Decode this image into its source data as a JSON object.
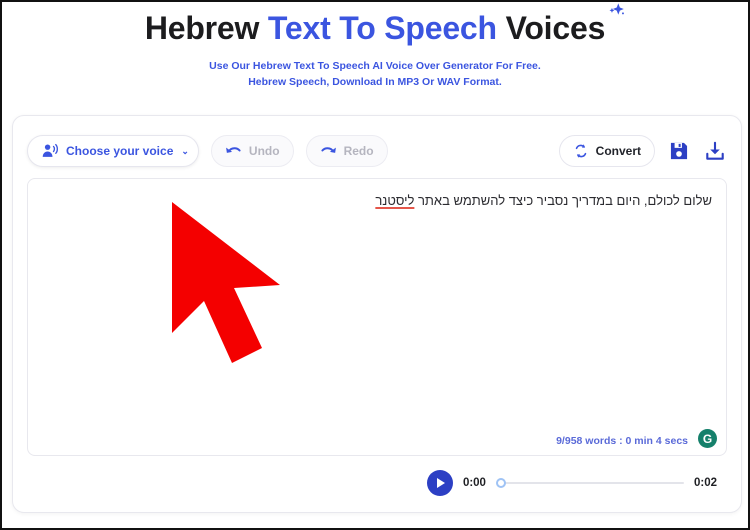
{
  "header": {
    "title_part1": "Hebrew ",
    "title_accent": "Text To Speech",
    "title_part2": " Voices",
    "sparkle_icon": "sparkle-icon",
    "subtitle_line1": "Use Our Hebrew Text To Speech AI Voice Over Generator For Free.",
    "subtitle_line2": "Hebrew Speech, Download In MP3 Or WAV Format."
  },
  "toolbar": {
    "voice_label": "Choose your voice",
    "voice_caret": "⌄",
    "voice_icon": "voice-person-icon",
    "undo_label": "Undo",
    "undo_icon": "undo-arrow-icon",
    "redo_label": "Redo",
    "redo_icon": "redo-arrow-icon",
    "convert_label": "Convert",
    "convert_icon": "refresh-cycle-icon",
    "save_icon": "floppy-save-icon",
    "download_icon": "download-icon"
  },
  "editor": {
    "text_before": "שלום לכולם, היום במדריך נסביר כיצד להשתמש באתר ",
    "text_misspelled": "ליסטנר",
    "counter": "9/958 words : 0 min 4 secs",
    "grammarly_letter": "G",
    "grammarly_icon": "grammarly-icon"
  },
  "player": {
    "play_icon": "play-icon",
    "current_time": "0:00",
    "total_time": "0:02",
    "progress_percent": 0
  },
  "cursor": {
    "icon": "mouse-cursor-arrow",
    "color": "#f40000"
  },
  "colors": {
    "accent_blue": "#3b55e0",
    "title_dark": "#1c1c1e",
    "grammarly_green": "#15806b",
    "misspell_red": "#e4564a"
  }
}
